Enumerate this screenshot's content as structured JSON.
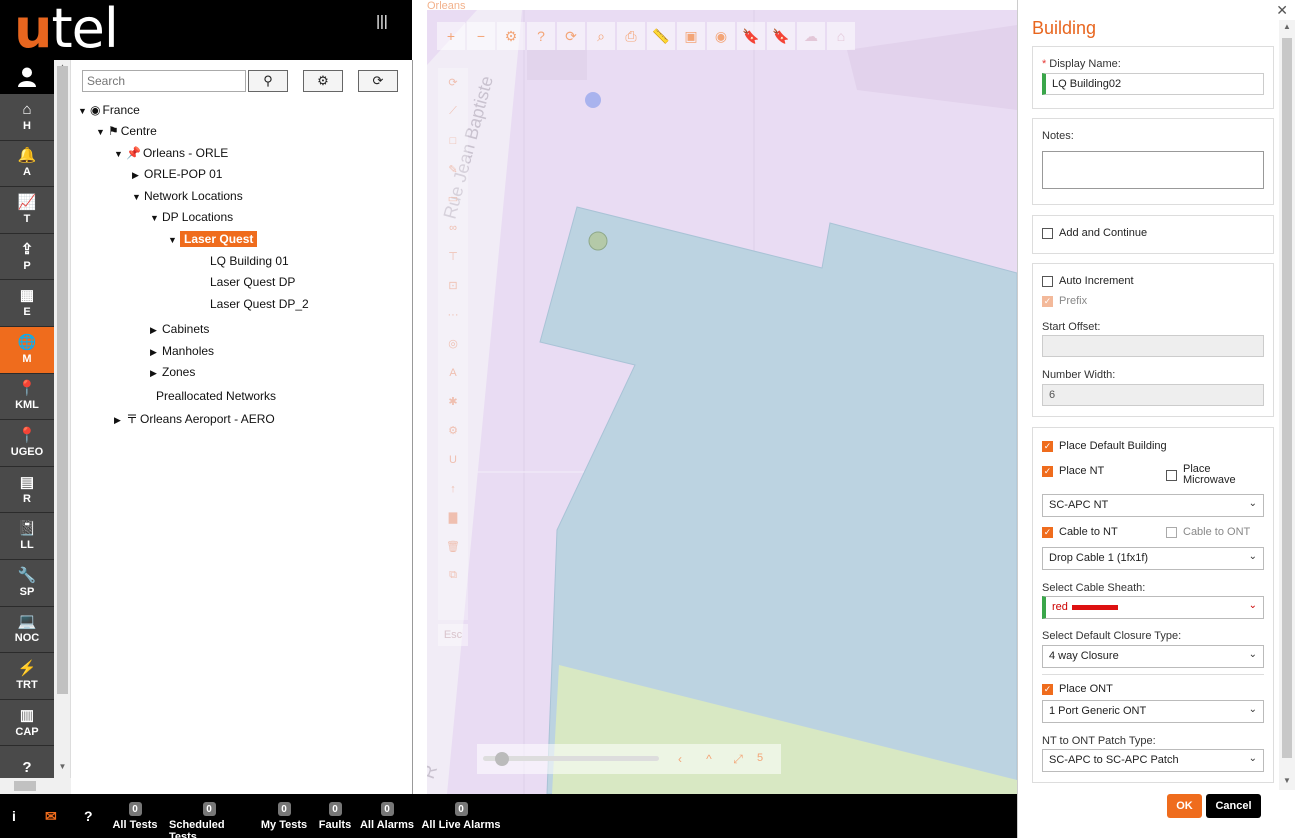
{
  "app": {
    "logo_u": "u",
    "logo_rest": "tel"
  },
  "rail": {
    "items": [
      {
        "icon": "⌂",
        "label": "H"
      },
      {
        "icon": "🔔",
        "label": "A"
      },
      {
        "icon": "📈",
        "label": "T"
      },
      {
        "icon": "⇪",
        "label": "P"
      },
      {
        "icon": "▦",
        "label": "E"
      },
      {
        "icon": "🌐",
        "label": "M"
      },
      {
        "icon": "📍",
        "label": "KML"
      },
      {
        "icon": "📍",
        "label": "UGEO"
      },
      {
        "icon": "▤",
        "label": "R"
      },
      {
        "icon": "📓",
        "label": "LL"
      },
      {
        "icon": "🔧",
        "label": "SP"
      },
      {
        "icon": "💻",
        "label": "NOC"
      },
      {
        "icon": "⚡",
        "label": "TRT"
      },
      {
        "icon": "▥",
        "label": "CAP"
      },
      {
        "icon": "?",
        "label": ""
      }
    ]
  },
  "tree": {
    "search_placeholder": "Search",
    "nodes": [
      {
        "toggle": "▼",
        "icon": "◉",
        "label": "France"
      },
      {
        "toggle": "▼",
        "icon": "⚑",
        "label": "Centre"
      },
      {
        "toggle": "▼",
        "icon": "📌",
        "label": "Orleans - ORLE"
      },
      {
        "toggle": "▶",
        "icon": "",
        "label": "ORLE-POP 01"
      },
      {
        "toggle": "▼",
        "icon": "",
        "label": "Network Locations"
      },
      {
        "toggle": "▼",
        "icon": "",
        "label": "DP Locations"
      },
      {
        "toggle": "▼",
        "icon": "",
        "label": "Laser Quest"
      },
      {
        "toggle": "",
        "icon": "",
        "label": "LQ Building 01"
      },
      {
        "toggle": "",
        "icon": "",
        "label": "Laser Quest DP"
      },
      {
        "toggle": "",
        "icon": "",
        "label": "Laser Quest DP_2"
      },
      {
        "toggle": "▶",
        "icon": "",
        "label": "Cabinets"
      },
      {
        "toggle": "▶",
        "icon": "",
        "label": "Manholes"
      },
      {
        "toggle": "▶",
        "icon": "",
        "label": "Zones"
      },
      {
        "toggle": "",
        "icon": "",
        "label": "Preallocated Networks"
      },
      {
        "toggle": "▶",
        "icon": "〒",
        "label": "Orleans Aeroport - AERO"
      }
    ]
  },
  "map": {
    "title": "Orleans",
    "street_label": "Rue Jean Baptiste",
    "street_label_2": "R",
    "esc_label": "Esc",
    "zoom_level": "5"
  },
  "form": {
    "title": "Building",
    "display_name_label": "Display Name:",
    "display_name_value": "LQ Building02",
    "notes_label": "Notes:",
    "add_continue_label": "Add and Continue",
    "auto_increment_label": "Auto Increment",
    "prefix_label": "Prefix",
    "start_offset_label": "Start Offset:",
    "start_offset_value": "",
    "number_width_label": "Number Width:",
    "number_width_value": "6",
    "place_default_building_label": "Place Default Building",
    "place_nt_label": "Place NT",
    "place_microwave_label": "Place Microwave",
    "nt_type_value": "SC-APC NT",
    "cable_to_nt_label": "Cable to NT",
    "cable_to_ont_label": "Cable to ONT",
    "cable_value": "Drop Cable 1 (1fx1f)",
    "sheath_label": "Select Cable Sheath:",
    "sheath_value": "red",
    "closure_label": "Select Default Closure Type:",
    "closure_value": "4 way Closure",
    "place_ont_label": "Place ONT",
    "ont_value": "1 Port Generic ONT",
    "patch_label": "NT to ONT Patch Type:",
    "patch_value": "SC-APC to SC-APC Patch",
    "ok_label": "OK",
    "cancel_label": "Cancel"
  },
  "statusbar": {
    "items": [
      {
        "count": "0",
        "label": "All Tests"
      },
      {
        "count": "0",
        "label": "Scheduled Tests"
      },
      {
        "count": "0",
        "label": "My Tests"
      },
      {
        "count": "0",
        "label": "Faults"
      },
      {
        "count": "0",
        "label": "All Alarms"
      },
      {
        "count": "0",
        "label": "All Live Alarms"
      }
    ]
  },
  "colors": {
    "accent": "#ef6c1d",
    "rail": "#4a4a4a",
    "map_bg": "#e9dcf3",
    "building": "#bcd3e1",
    "green_area": "#d8e8c3"
  }
}
